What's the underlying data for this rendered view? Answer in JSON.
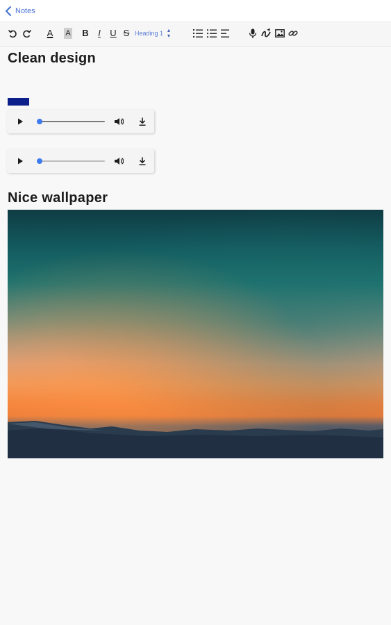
{
  "topbar": {
    "back_label": "Notes"
  },
  "toolbar": {
    "heading_select_value": "Heading 1",
    "format_letters": {
      "font_color": "A",
      "highlight": "A",
      "bold": "B",
      "italic": "I",
      "underline": "U",
      "strike": "S"
    },
    "items": [
      {
        "name": "undo-icon"
      },
      {
        "name": "redo-icon"
      },
      {
        "name": "font-color-icon"
      },
      {
        "name": "highlight-icon"
      },
      {
        "name": "bold-icon"
      },
      {
        "name": "italic-icon"
      },
      {
        "name": "underline-icon"
      },
      {
        "name": "strikethrough-icon"
      },
      {
        "name": "numbered-list-icon"
      },
      {
        "name": "bulleted-list-icon"
      },
      {
        "name": "align-left-icon"
      },
      {
        "name": "microphone-icon"
      },
      {
        "name": "drawing-icon"
      },
      {
        "name": "image-icon"
      },
      {
        "name": "link-icon"
      }
    ]
  },
  "document": {
    "heading_1": "Clean design",
    "heading_2": "Nice wallpaper",
    "audio_players": [
      {
        "progress": 0.0
      },
      {
        "progress": 0.0
      }
    ]
  },
  "colors": {
    "accent": "#3d7af0",
    "selection": "#0d1f8a",
    "link_blue": "#4a6fd6"
  }
}
